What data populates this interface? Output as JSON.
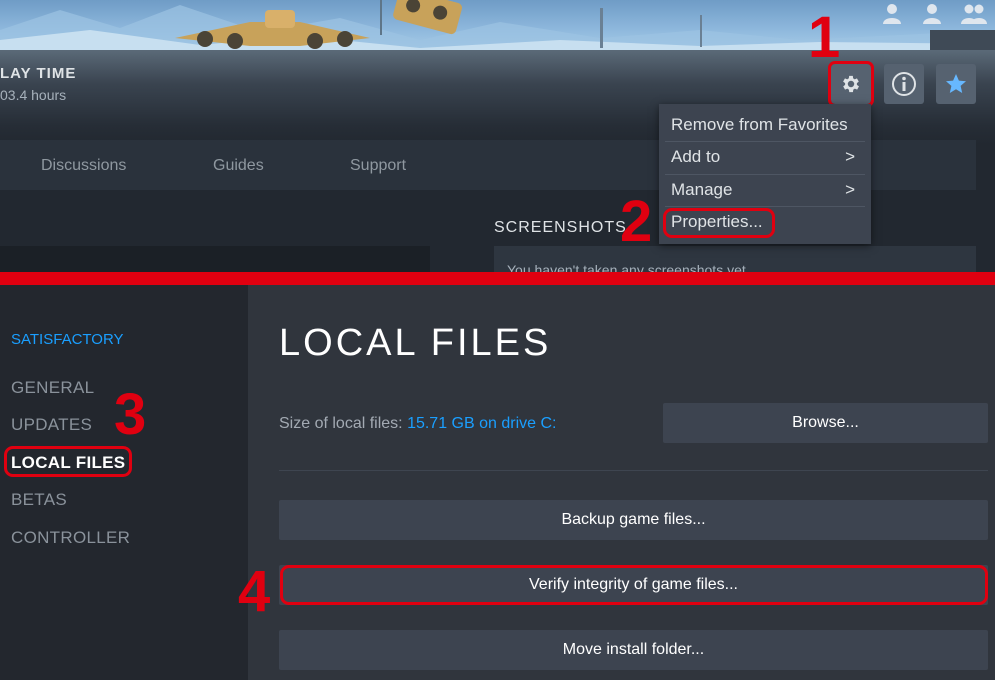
{
  "header": {
    "playtime_label": "LAY TIME",
    "playtime_value": "03.4 hours"
  },
  "toolbar": {
    "settings_icon": "gear-icon",
    "info_icon": "info-icon",
    "favorite_icon": "star-icon"
  },
  "tabs": [
    {
      "label": "Discussions"
    },
    {
      "label": "Guides"
    },
    {
      "label": "Support"
    }
  ],
  "screenshots": {
    "title": "SCREENSHOTS",
    "empty_text": "You haven't taken any screenshots yet"
  },
  "context_menu": {
    "items": [
      {
        "label": "Remove from Favorites",
        "submenu": false
      },
      {
        "label": "Add to",
        "submenu": true,
        "chevron": ">"
      },
      {
        "label": "Manage",
        "submenu": true,
        "chevron": ">"
      },
      {
        "label": "Properties...",
        "submenu": false
      }
    ]
  },
  "steps": {
    "one": "1",
    "two": "2",
    "three": "3",
    "four": "4"
  },
  "sidebar": {
    "game_title": "SATISFACTORY",
    "items": [
      {
        "label": "GENERAL"
      },
      {
        "label": "UPDATES"
      },
      {
        "label": "LOCAL FILES"
      },
      {
        "label": "BETAS"
      },
      {
        "label": "CONTROLLER"
      }
    ]
  },
  "local_files": {
    "title": "LOCAL FILES",
    "size_label": "Size of local files: ",
    "size_value": "15.71 GB on drive C:",
    "browse_button": "Browse...",
    "backup_button": "Backup game files...",
    "verify_button": "Verify integrity of game files...",
    "move_button": "Move install folder..."
  },
  "colors": {
    "highlight_red": "#e00010",
    "accent_blue": "#1a9fff",
    "button_bg": "#3d4450"
  }
}
